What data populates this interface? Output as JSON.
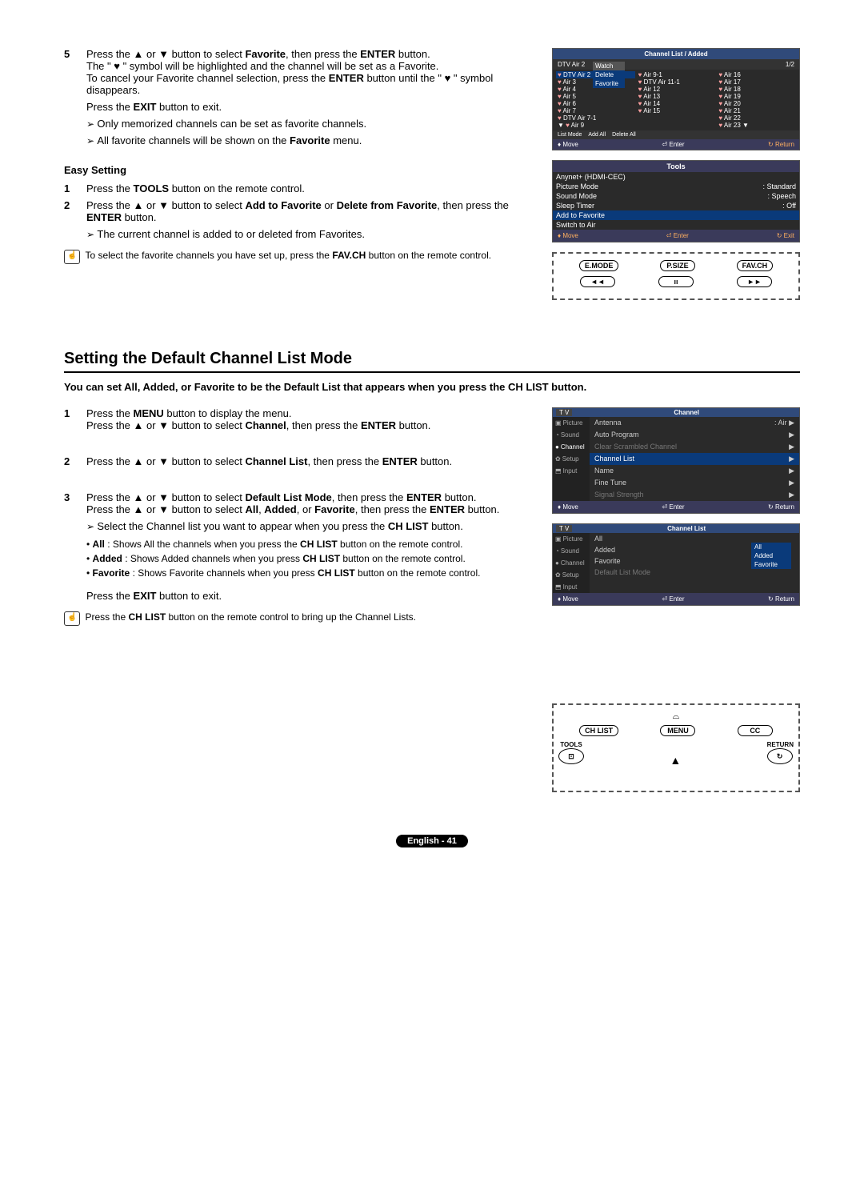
{
  "step5": {
    "num": "5",
    "text1_a": "Press the ▲ or ▼ button to select ",
    "text1_fav": "Favorite",
    "text1_b": ", then press the ",
    "text1_enter": "ENTER",
    "text1_c": " button.",
    "text2": "The \" ♥ \" symbol will be highlighted and the channel will be set as a Favorite.",
    "text3_a": "To cancel your Favorite channel selection, press the ",
    "text3_enter": "ENTER",
    "text3_b": " button until the \" ♥ \" symbol disappears.",
    "exit_a": "Press the ",
    "exit_b": "EXIT",
    "exit_c": " button to exit.",
    "bullet1": "Only memorized channels can be set as favorite channels.",
    "bullet2_a": "All favorite channels will be shown on the ",
    "bullet2_b": "Favorite",
    "bullet2_c": " menu."
  },
  "easy": {
    "heading": "Easy Setting",
    "s1num": "1",
    "s1_a": "Press the ",
    "s1_tools": "TOOLS",
    "s1_b": " button on the remote control.",
    "s2num": "2",
    "s2_a": "Press the ▲ or ▼ button to select ",
    "s2_add": "Add to Favorite",
    "s2_or": " or ",
    "s2_del": "Delete from Favorite",
    "s2_b": ", then press the ",
    "s2_enter": "ENTER",
    "s2_c": " button.",
    "bullet": "The current channel is added to or deleted from Favorites.",
    "note_a": "To select the favorite channels you have set up, press the ",
    "note_b": "FAV.CH",
    "note_c": " button on the remote control."
  },
  "section2": {
    "title": "Setting the Default Channel List Mode",
    "intro": "You can set All, Added, or Favorite to be the Default List that appears when you press the CH LIST button.",
    "s1num": "1",
    "s1_a": "Press the ",
    "s1_menu": "MENU",
    "s1_b": " button to display the menu.",
    "s1_c": "Press the ▲ or ▼ button to select ",
    "s1_ch": "Channel",
    "s1_d": ", then press the ",
    "s1_enter": "ENTER",
    "s1_e": " button.",
    "s2num": "2",
    "s2_a": "Press the ▲ or ▼ button to select ",
    "s2_cl": "Channel List",
    "s2_b": ", then press the ",
    "s2_enter": "ENTER",
    "s2_c": " button.",
    "s3num": "3",
    "s3_a": "Press the ▲ or ▼ button to select ",
    "s3_dlm": "Default List Mode",
    "s3_b": ", then press the ",
    "s3_enter": "ENTER",
    "s3_c": " button.",
    "s3_d": "Press the ▲ or ▼ button to select ",
    "s3_all": "All",
    "s3_comma1": ", ",
    "s3_added": "Added",
    "s3_or": ", or ",
    "s3_fav": "Favorite",
    "s3_e": ", then press the ",
    "s3_enter2": "ENTER",
    "s3_f": " button.",
    "arrow_a": "Select the Channel list you want to appear when you press the ",
    "arrow_b": "CH LIST",
    "arrow_c": " button.",
    "b1_a": "All",
    "b1_b": " : Shows All the channels when you press the ",
    "b1_c": "CH LIST",
    "b1_d": " button on the remote control.",
    "b2_a": "Added",
    "b2_b": " : Shows Added channels when you press ",
    "b2_c": "CH LIST",
    "b2_d": " button on the remote control.",
    "b3_a": "Favorite",
    "b3_b": " : Shows Favorite channels when you press ",
    "b3_c": "CH LIST",
    "b3_d": " button on the remote control.",
    "exit_a": "Press the ",
    "exit_b": "EXIT",
    "exit_c": " button to exit.",
    "note_a": "Press the ",
    "note_b": "CH LIST",
    "note_c": " button on the remote control to bring up the Channel Lists."
  },
  "channel_list": {
    "title": "Channel List / Added",
    "sub_left": "DTV Air 2",
    "sub_right": "1/2",
    "col1": [
      "DTV Air 2",
      "Air 3",
      "Air 4",
      "Air 5",
      "Air 6",
      "Air 7",
      "DTV Air 7-1",
      "Air 9"
    ],
    "col2": [
      "Air 9-1",
      "",
      "",
      "DTV Air 11-1",
      "Air 12",
      "Air 13",
      "Air 14",
      "Air 15"
    ],
    "col3": [
      "Air 16",
      "Air 17",
      "Air 18",
      "Air 19",
      "Air 20",
      "Air 21",
      "Air 22",
      "Air 23"
    ],
    "popup": [
      "Watch",
      "Delete",
      "Favorite"
    ],
    "f1_a": "List Mode",
    "f1_b": "Add All",
    "f1_c": "Delete All",
    "f2_move": "Move",
    "f2_enter": "Enter",
    "f2_return": "Return"
  },
  "tools_panel": {
    "title": "Tools",
    "items": [
      {
        "l": "Anynet+ (HDMI-CEC)",
        "r": ""
      },
      {
        "l": "Picture Mode",
        "r": "Standard"
      },
      {
        "l": "Sound Mode",
        "r": "Speech"
      },
      {
        "l": "Sleep Timer",
        "r": "Off"
      }
    ],
    "hl": "Add to Favorite",
    "after": "Switch to Air",
    "f_move": "Move",
    "f_enter": "Enter",
    "f_exit": "Exit"
  },
  "remote1": {
    "b1": "E.MODE",
    "b2": "P.SIZE",
    "b3": "FAV.CH",
    "r2a": "◄◄",
    "r2b": "ıı",
    "r2c": "►►"
  },
  "menu1": {
    "head_tv": "T V",
    "title": "Channel",
    "side": [
      "Picture",
      "Sound",
      "Channel",
      "Setup",
      "Input"
    ],
    "items": [
      {
        "l": "Antenna",
        "r": ": Air",
        "cls": ""
      },
      {
        "l": "Auto Program",
        "r": "",
        "cls": ""
      },
      {
        "l": "Clear Scrambled Channel",
        "r": "",
        "cls": "menu-dis"
      },
      {
        "l": "Channel List",
        "r": "",
        "cls": "menu-hl"
      },
      {
        "l": "Name",
        "r": "",
        "cls": ""
      },
      {
        "l": "Fine Tune",
        "r": "",
        "cls": ""
      },
      {
        "l": "Signal Strength",
        "r": "",
        "cls": "menu-dis"
      }
    ],
    "f_move": "Move",
    "f_enter": "Enter",
    "f_return": "Return"
  },
  "menu2": {
    "head_tv": "T V",
    "title": "Channel List",
    "side": [
      "Picture",
      "Sound",
      "Channel",
      "Setup",
      "Input"
    ],
    "items": [
      {
        "l": "All",
        "r": ""
      },
      {
        "l": "Added",
        "r": ""
      },
      {
        "l": "Favorite",
        "r": ""
      },
      {
        "l": "Default List Mode",
        "r": "",
        "cls": "menu-hl menu-dis"
      }
    ],
    "dd": [
      "All",
      "Added",
      "Favorite"
    ],
    "f_move": "Move",
    "f_enter": "Enter",
    "f_return": "Return"
  },
  "remote2": {
    "b1": "CH LIST",
    "b2": "MENU",
    "b3": "CC",
    "l1": "TOOLS",
    "l2": "RETURN"
  },
  "footer": "English - 41"
}
